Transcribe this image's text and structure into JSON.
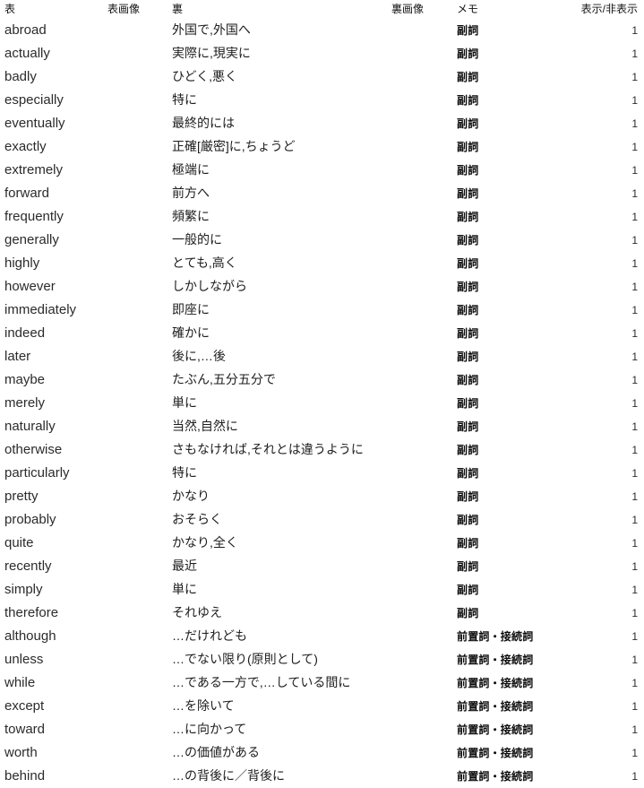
{
  "table": {
    "columns": [
      {
        "key": "front",
        "label": "表",
        "align": "left"
      },
      {
        "key": "front_img",
        "label": "表画像",
        "align": "left"
      },
      {
        "key": "back",
        "label": "裏",
        "align": "left"
      },
      {
        "key": "back_img",
        "label": "裏画像",
        "align": "left"
      },
      {
        "key": "memo",
        "label": "メモ",
        "align": "left"
      },
      {
        "key": "visible",
        "label": "表示/非表示",
        "align": "right"
      }
    ],
    "rows": [
      {
        "front": "abroad",
        "front_img": "",
        "back": "外国で,外国へ",
        "back_img": "",
        "memo": "副詞",
        "visible": "1"
      },
      {
        "front": "actually",
        "front_img": "",
        "back": "実際に,現実に",
        "back_img": "",
        "memo": "副詞",
        "visible": "1"
      },
      {
        "front": "badly",
        "front_img": "",
        "back": "ひどく,悪く",
        "back_img": "",
        "memo": "副詞",
        "visible": "1"
      },
      {
        "front": "especially",
        "front_img": "",
        "back": "特に",
        "back_img": "",
        "memo": "副詞",
        "visible": "1"
      },
      {
        "front": "eventually",
        "front_img": "",
        "back": "最終的には",
        "back_img": "",
        "memo": "副詞",
        "visible": "1"
      },
      {
        "front": "exactly",
        "front_img": "",
        "back": "正確[厳密]に,ちょうど",
        "back_img": "",
        "memo": "副詞",
        "visible": "1"
      },
      {
        "front": "extremely",
        "front_img": "",
        "back": "極端に",
        "back_img": "",
        "memo": "副詞",
        "visible": "1"
      },
      {
        "front": "forward",
        "front_img": "",
        "back": "前方へ",
        "back_img": "",
        "memo": "副詞",
        "visible": "1"
      },
      {
        "front": "frequently",
        "front_img": "",
        "back": "頻繁に",
        "back_img": "",
        "memo": "副詞",
        "visible": "1"
      },
      {
        "front": "generally",
        "front_img": "",
        "back": "一般的に",
        "back_img": "",
        "memo": "副詞",
        "visible": "1"
      },
      {
        "front": "highly",
        "front_img": "",
        "back": "とても,高く",
        "back_img": "",
        "memo": "副詞",
        "visible": "1"
      },
      {
        "front": "however",
        "front_img": "",
        "back": "しかしながら",
        "back_img": "",
        "memo": "副詞",
        "visible": "1"
      },
      {
        "front": "immediately",
        "front_img": "",
        "back": "即座に",
        "back_img": "",
        "memo": "副詞",
        "visible": "1"
      },
      {
        "front": "indeed",
        "front_img": "",
        "back": "確かに",
        "back_img": "",
        "memo": "副詞",
        "visible": "1"
      },
      {
        "front": "later",
        "front_img": "",
        "back": "後に,…後",
        "back_img": "",
        "memo": "副詞",
        "visible": "1"
      },
      {
        "front": "maybe",
        "front_img": "",
        "back": "たぶん,五分五分で",
        "back_img": "",
        "memo": "副詞",
        "visible": "1"
      },
      {
        "front": "merely",
        "front_img": "",
        "back": "単に",
        "back_img": "",
        "memo": "副詞",
        "visible": "1"
      },
      {
        "front": "naturally",
        "front_img": "",
        "back": "当然,自然に",
        "back_img": "",
        "memo": "副詞",
        "visible": "1"
      },
      {
        "front": "otherwise",
        "front_img": "",
        "back": "さもなければ,それとは違うように",
        "back_img": "",
        "memo": "副詞",
        "visible": "1"
      },
      {
        "front": "particularly",
        "front_img": "",
        "back": "特に",
        "back_img": "",
        "memo": "副詞",
        "visible": "1"
      },
      {
        "front": "pretty",
        "front_img": "",
        "back": "かなり",
        "back_img": "",
        "memo": "副詞",
        "visible": "1"
      },
      {
        "front": "probably",
        "front_img": "",
        "back": "おそらく",
        "back_img": "",
        "memo": "副詞",
        "visible": "1"
      },
      {
        "front": "quite",
        "front_img": "",
        "back": "かなり,全く",
        "back_img": "",
        "memo": "副詞",
        "visible": "1"
      },
      {
        "front": "recently",
        "front_img": "",
        "back": "最近",
        "back_img": "",
        "memo": "副詞",
        "visible": "1"
      },
      {
        "front": "simply",
        "front_img": "",
        "back": "単に",
        "back_img": "",
        "memo": "副詞",
        "visible": "1"
      },
      {
        "front": "therefore",
        "front_img": "",
        "back": "それゆえ",
        "back_img": "",
        "memo": "副詞",
        "visible": "1"
      },
      {
        "front": "although",
        "front_img": "",
        "back": "…だけれども",
        "back_img": "",
        "memo": "前置詞・接続詞",
        "visible": "1"
      },
      {
        "front": "unless",
        "front_img": "",
        "back": "…でない限り(原則として)",
        "back_img": "",
        "memo": "前置詞・接続詞",
        "visible": "1"
      },
      {
        "front": "while",
        "front_img": "",
        "back": "…である一方で,…している間に",
        "back_img": "",
        "memo": "前置詞・接続詞",
        "visible": "1"
      },
      {
        "front": "except",
        "front_img": "",
        "back": "…を除いて",
        "back_img": "",
        "memo": "前置詞・接続詞",
        "visible": "1"
      },
      {
        "front": "toward",
        "front_img": "",
        "back": "…に向かって",
        "back_img": "",
        "memo": "前置詞・接続詞",
        "visible": "1"
      },
      {
        "front": "worth",
        "front_img": "",
        "back": "…の価値がある",
        "back_img": "",
        "memo": "前置詞・接続詞",
        "visible": "1"
      },
      {
        "front": "behind",
        "front_img": "",
        "back": "…の背後に／背後に",
        "back_img": "",
        "memo": "前置詞・接続詞",
        "visible": "1"
      }
    ]
  }
}
